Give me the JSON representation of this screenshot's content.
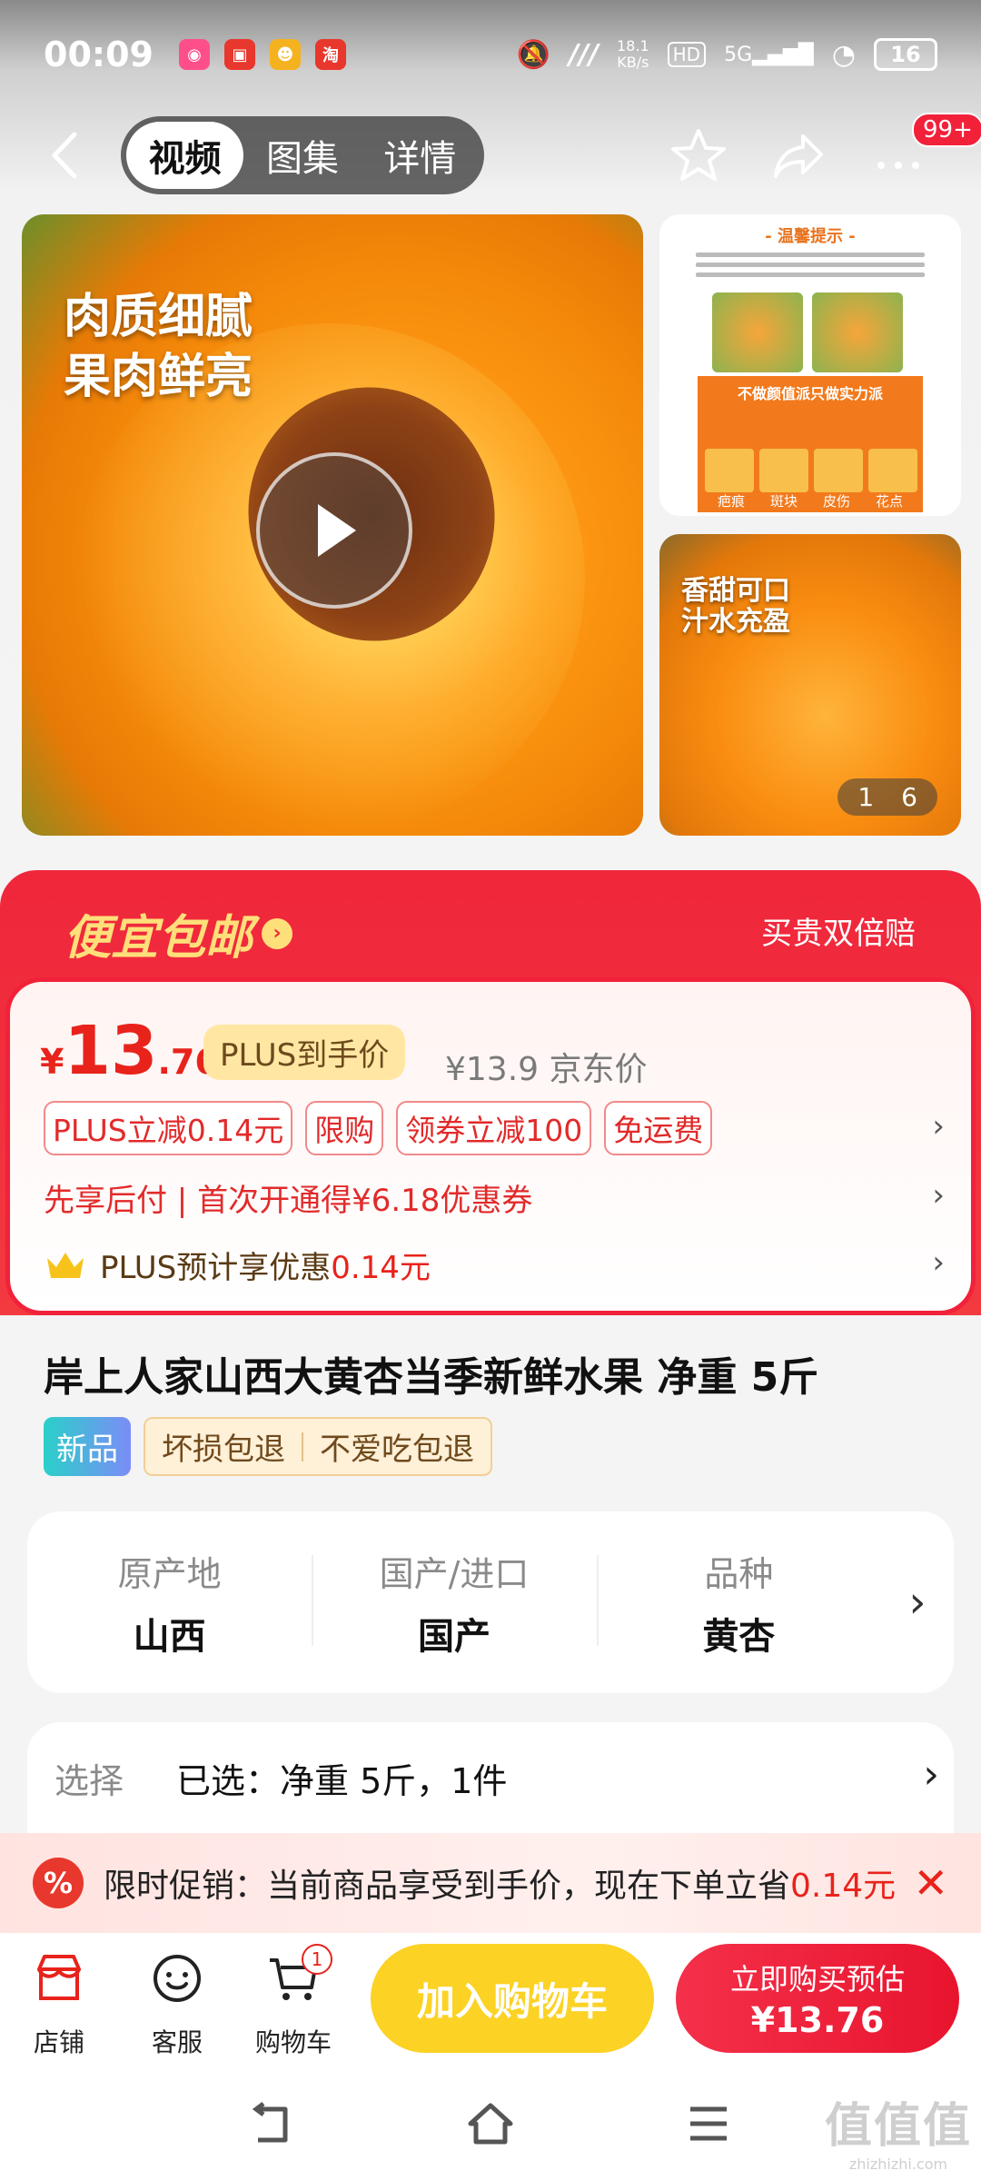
{
  "status_bar": {
    "time": "00:09",
    "net_speed": "18.1",
    "net_unit": "KB/s",
    "hd": "HD",
    "signal": "5G",
    "battery": "16"
  },
  "nav": {
    "tabs": [
      {
        "label": "视频",
        "active": true
      },
      {
        "label": "图集",
        "active": false
      },
      {
        "label": "详情",
        "active": false
      }
    ],
    "badge": "99+"
  },
  "media": {
    "main_overlay_text_1": "肉质细腻",
    "main_overlay_text_2": "果肉鲜亮",
    "thumb1_title": "- 温馨提示 -",
    "thumb1_banner": "不做颜值派只做实力派",
    "thumb1_labels": [
      "疤痕",
      "斑块",
      "皮伤",
      "花点"
    ],
    "thumb2_text_1": "香甜可口",
    "thumb2_text_2": "汁水充盈",
    "page_current": "1",
    "page_total": "6"
  },
  "promo": {
    "title": "便宜包邮",
    "right_text": "买贵双倍赔"
  },
  "price": {
    "currency": "¥",
    "integer": "13",
    "decimal": ".76",
    "plus_tag": "PLUS到手价",
    "jd_price": "¥13.9 京东价",
    "tags": [
      "PLUS立减0.14元",
      "限购",
      "领券立减100",
      "免运费"
    ],
    "pay_line": "先享后付 | 首次开通得¥6.18优惠券",
    "plus_line_prefix": "PLUS预计享优惠",
    "plus_line_amount": "0.14元"
  },
  "product": {
    "title": "岸上人家山西大黄杏当季新鲜水果 净重 5斤",
    "new_tag": "新品",
    "guarantees": [
      "坏损包退",
      "不爱吃包退"
    ]
  },
  "attributes": [
    {
      "label": "原产地",
      "value": "山西"
    },
    {
      "label": "国产/进口",
      "value": "国产"
    },
    {
      "label": "品种",
      "value": "黄杏"
    }
  ],
  "selection": {
    "label": "选择",
    "value": "已选：净重 5斤，1件"
  },
  "promo_strip": {
    "icon": "%",
    "text": "限时促销：当前商品享受到手价，现在下单立省",
    "amount": "0.14元"
  },
  "bottom_bar": {
    "shop": "店铺",
    "service": "客服",
    "cart": "购物车",
    "cart_count": "1",
    "add_cart": "加入购物车",
    "buy_line1": "立即购买预估",
    "buy_line2": "¥13.76"
  },
  "watermark": {
    "big": "值值值",
    "small": "zhizhizhi.com"
  },
  "colors": {
    "brand_red": "#f2213a",
    "price_red": "#e8231b",
    "cart_yellow": "#fcd224",
    "promo_gold": "#ffdf7a"
  }
}
